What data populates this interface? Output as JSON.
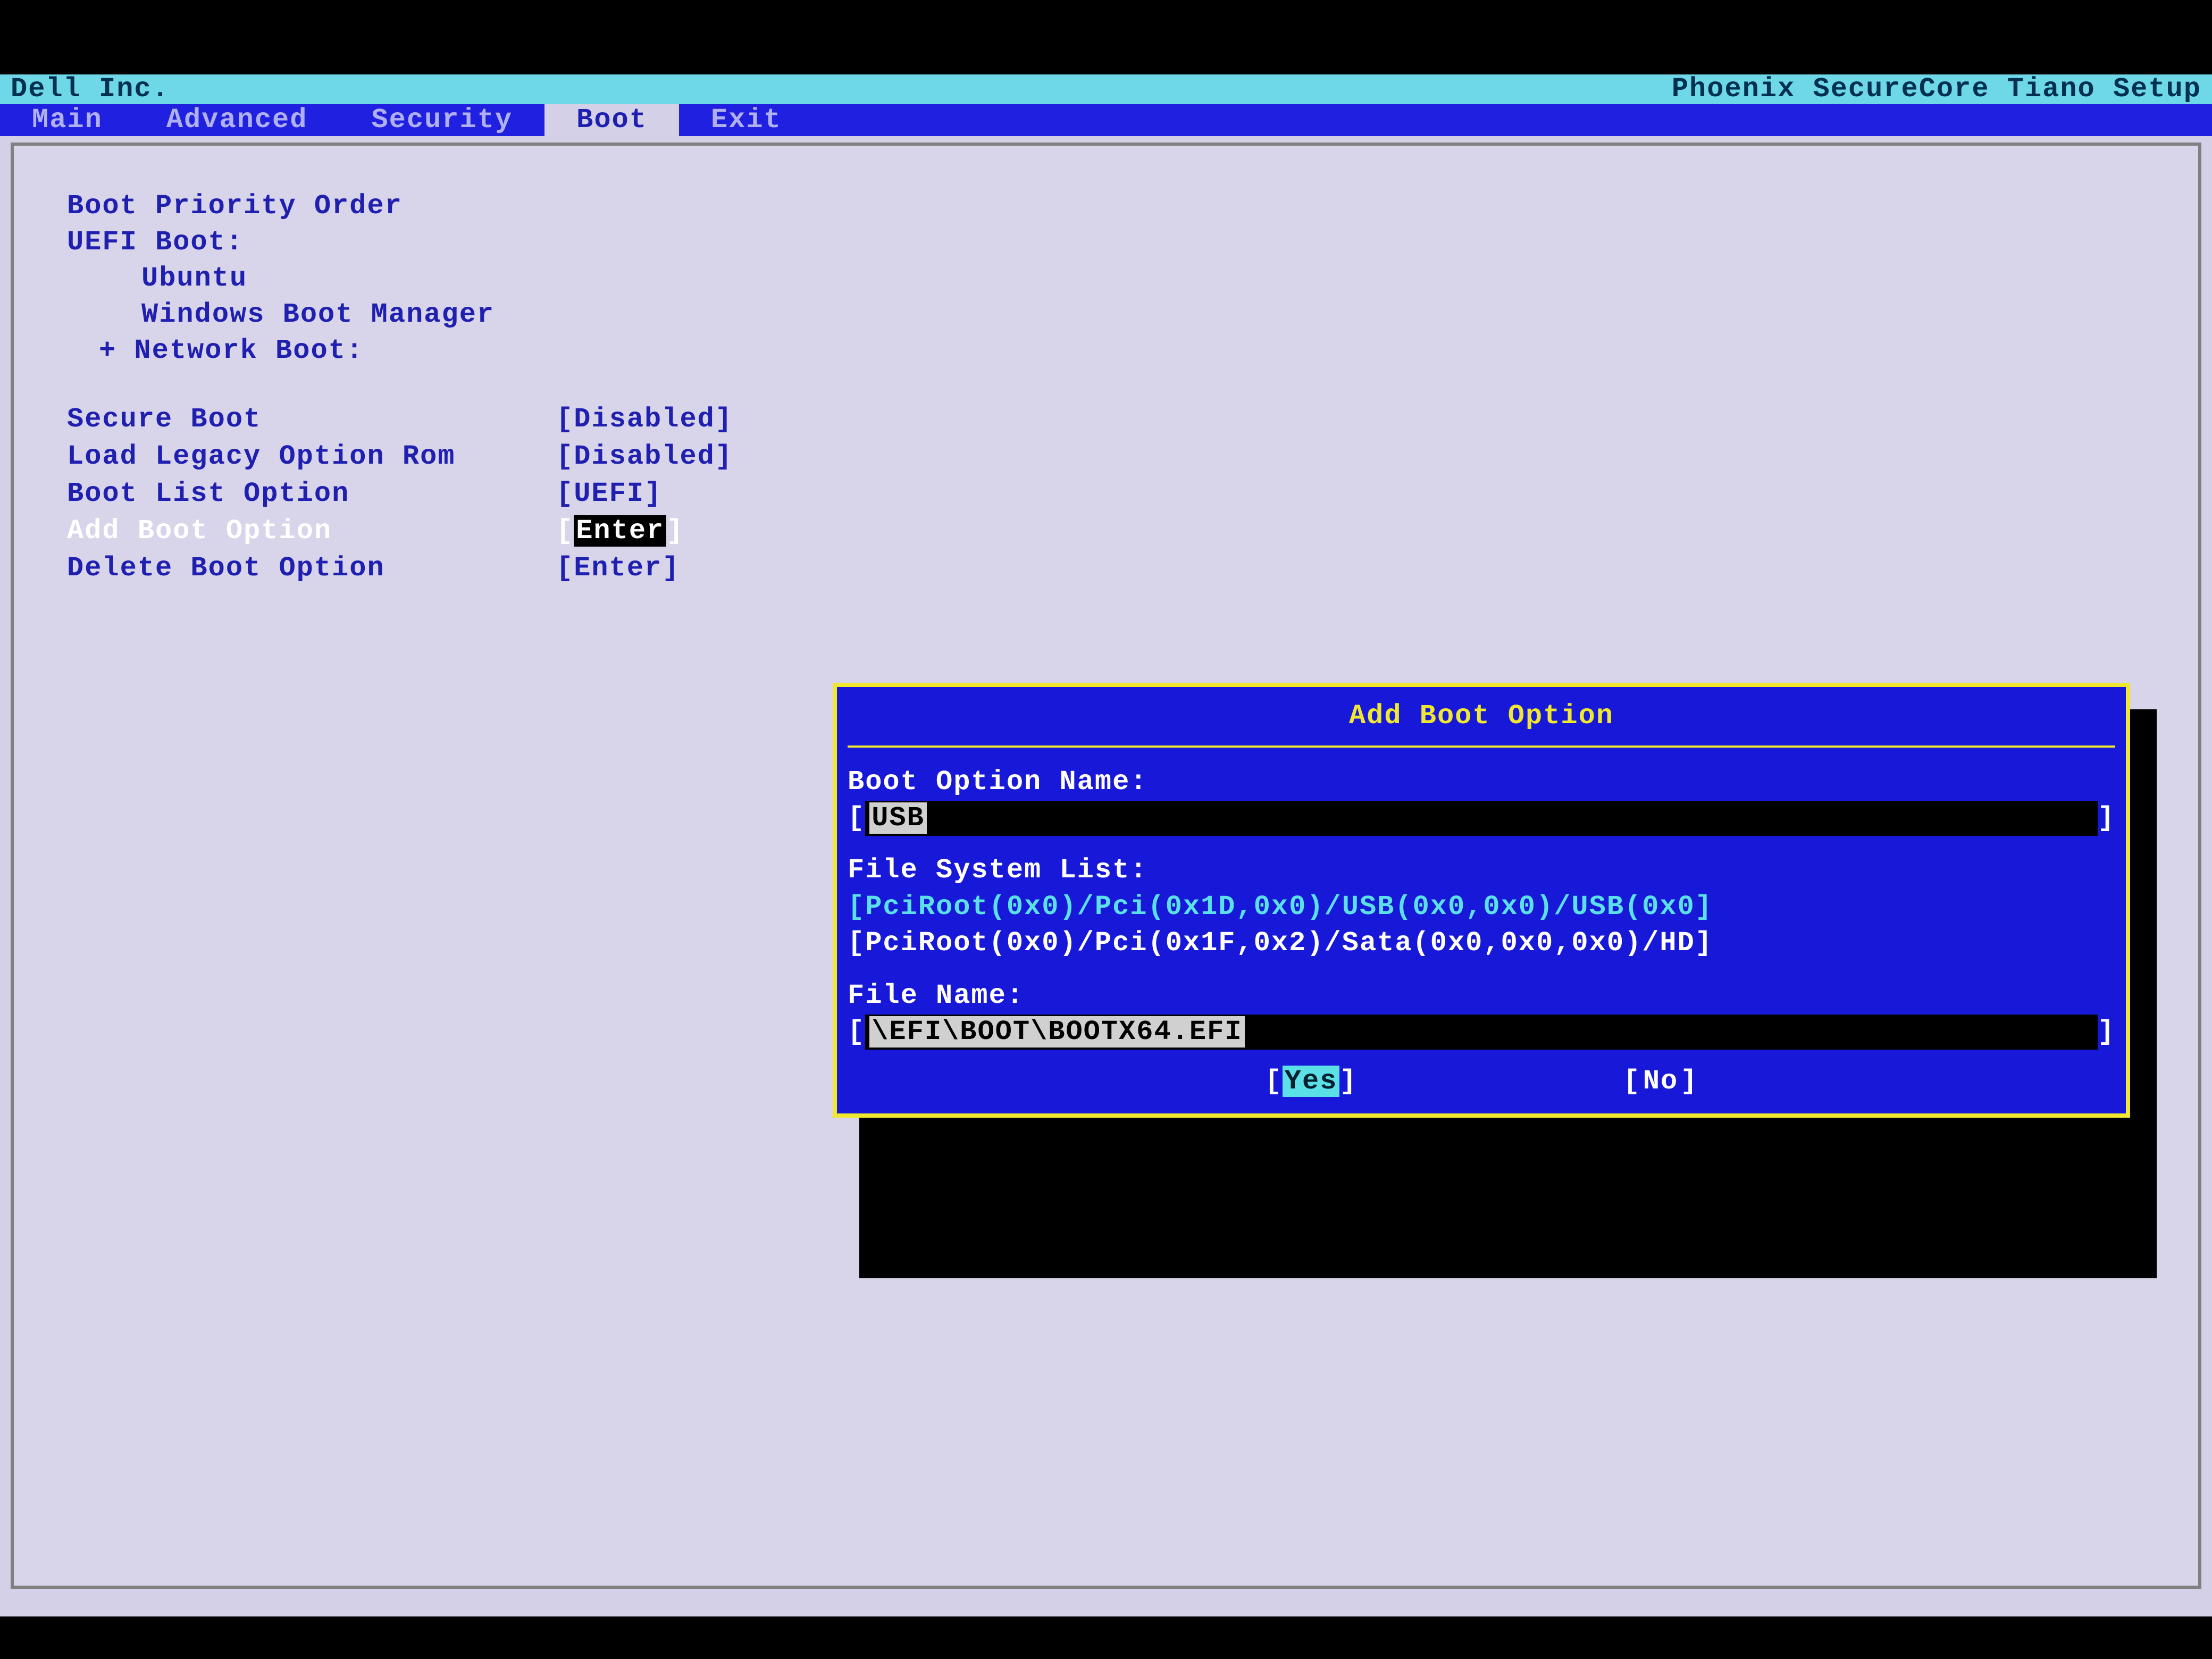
{
  "title_left": "Dell Inc.",
  "title_right": "Phoenix SecureCore Tiano Setup",
  "tabs": {
    "main": "Main",
    "advanced": "Advanced",
    "security": "Security",
    "boot": "Boot",
    "exit": "Exit"
  },
  "boot_priority_heading": "Boot Priority Order",
  "uefi_boot_heading": "UEFI Boot:",
  "boot_order": {
    "item1": "Ubuntu",
    "item2": "Windows Boot Manager",
    "item3": "+ Network Boot:"
  },
  "settings": {
    "secure_boot": {
      "label": "Secure Boot",
      "value": "Disabled"
    },
    "legacy_rom": {
      "label": "Load Legacy Option Rom",
      "value": "Disabled"
    },
    "boot_list": {
      "label": "Boot List Option",
      "value": "UEFI"
    },
    "add_boot": {
      "label": "Add Boot Option",
      "value": "Enter"
    },
    "delete_boot": {
      "label": "Delete Boot Option",
      "value": "Enter"
    }
  },
  "dialog": {
    "title": "Add Boot Option",
    "name_label": "Boot Option Name:",
    "name_value": "USB",
    "fs_label": "File System List:",
    "fs_item1": "[PciRoot(0x0)/Pci(0x1D,0x0)/USB(0x0,0x0)/USB(0x0]",
    "fs_item2": "[PciRoot(0x0)/Pci(0x1F,0x2)/Sata(0x0,0x0,0x0)/HD]",
    "file_label": "File Name:",
    "file_value": "\\EFI\\BOOT\\BOOTX64.EFI",
    "yes": "Yes",
    "no": "No"
  }
}
